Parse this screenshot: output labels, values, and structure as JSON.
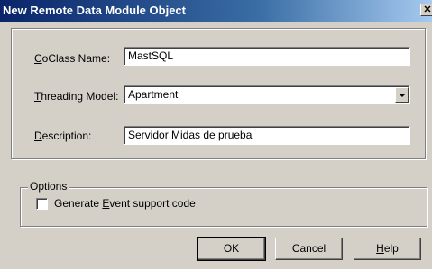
{
  "window": {
    "title": "New Remote Data Module Object",
    "close_glyph": "✕"
  },
  "form": {
    "coclass": {
      "label_accel": "C",
      "label_rest": "oClass Name:",
      "value": "MastSQL"
    },
    "threading": {
      "label_accel": "T",
      "label_rest": "hreading Model:",
      "value": "Apartment"
    },
    "description": {
      "label_accel": "D",
      "label_rest": "escription:",
      "value": "Servidor Midas de prueba"
    }
  },
  "options": {
    "legend": "Options",
    "event_support": {
      "label_before": "Generate ",
      "label_accel": "E",
      "label_after": "vent support code",
      "checked": false
    }
  },
  "buttons": {
    "ok": "OK",
    "cancel": "Cancel",
    "help_accel": "H",
    "help_rest": "elp"
  }
}
